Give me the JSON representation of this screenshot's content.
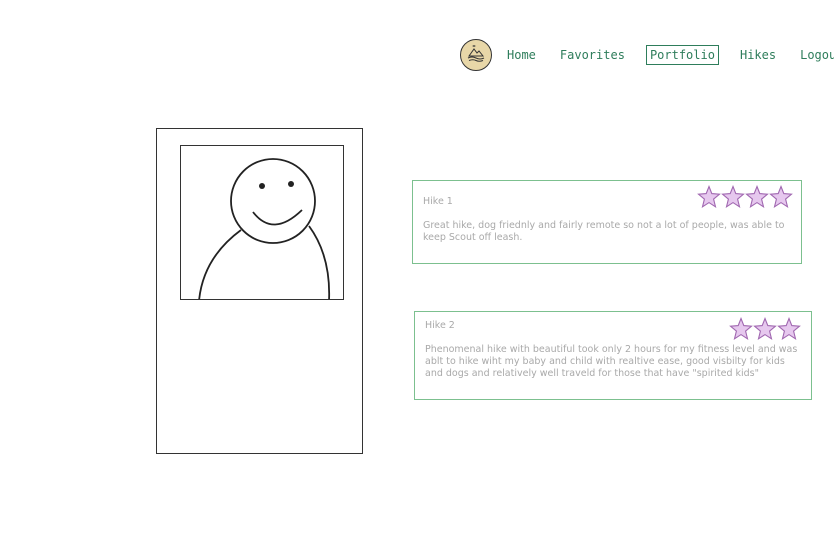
{
  "nav": {
    "logo_icon": "mountain-lake-icon",
    "items": [
      {
        "label": "Home",
        "active": false
      },
      {
        "label": "Favorites",
        "active": false
      },
      {
        "label": "Portfolio",
        "active": true
      },
      {
        "label": "Hikes",
        "active": false
      },
      {
        "label": "Logout",
        "active": false
      }
    ]
  },
  "profile": {
    "avatar_icon": "smiley-avatar-icon"
  },
  "reviews": [
    {
      "title": "Hike 1",
      "rating": 4,
      "text": "Great hike, dog friednly and fairly remote so not a lot of people, was able to keep Scout off leash."
    },
    {
      "title": "Hike 2",
      "rating": 3,
      "text": "Phenomenal hike with beautiful took only 2 hours for my fitness level and was ablt to hike wiht my baby and child with realtive ease, good visbilty for kids and dogs and relatively well traveld for those that have \"spirited kids\""
    }
  ],
  "colors": {
    "accent": "#2e7d5b",
    "card_border": "#7cc08f",
    "star_fill": "#e6c8ee",
    "star_stroke": "#a067b0",
    "muted_text": "#a9a9a9"
  }
}
